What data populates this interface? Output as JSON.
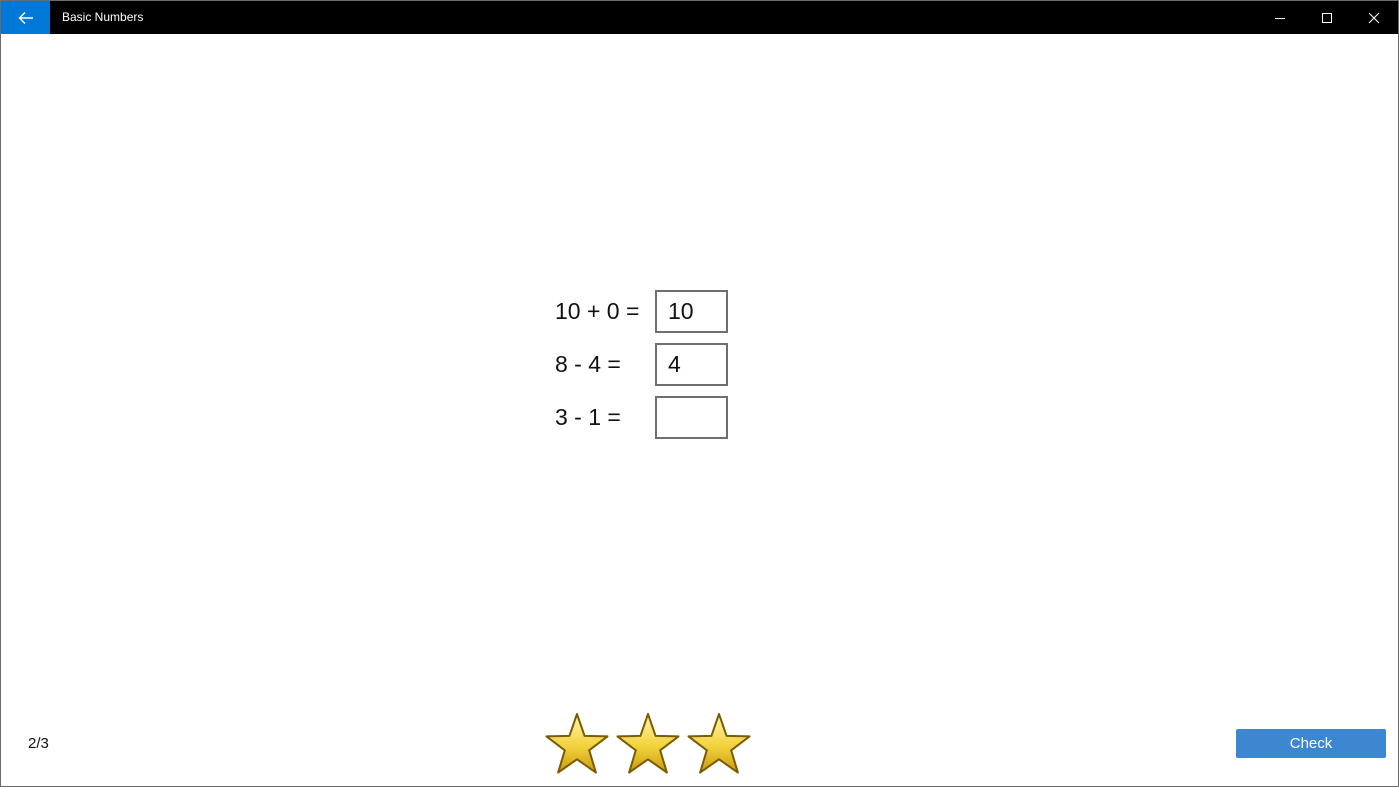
{
  "titlebar": {
    "title": "Basic Numbers",
    "back_icon": "arrow-left-icon",
    "minimize_icon": "minimize-icon",
    "maximize_icon": "maximize-icon",
    "close_icon": "close-icon",
    "accent_color": "#0078d7",
    "bar_color": "#000000"
  },
  "problems": [
    {
      "expression": "10 + 0 =",
      "answer": "10"
    },
    {
      "expression": "8 - 4 =",
      "answer": "4"
    },
    {
      "expression": "3 - 1 =",
      "answer": ""
    }
  ],
  "footer": {
    "progress": "2/3",
    "stars": {
      "count": 3,
      "icon": "star-icon",
      "color": "#f2d23c"
    },
    "check_label": "Check",
    "check_color": "#3c87cf"
  }
}
